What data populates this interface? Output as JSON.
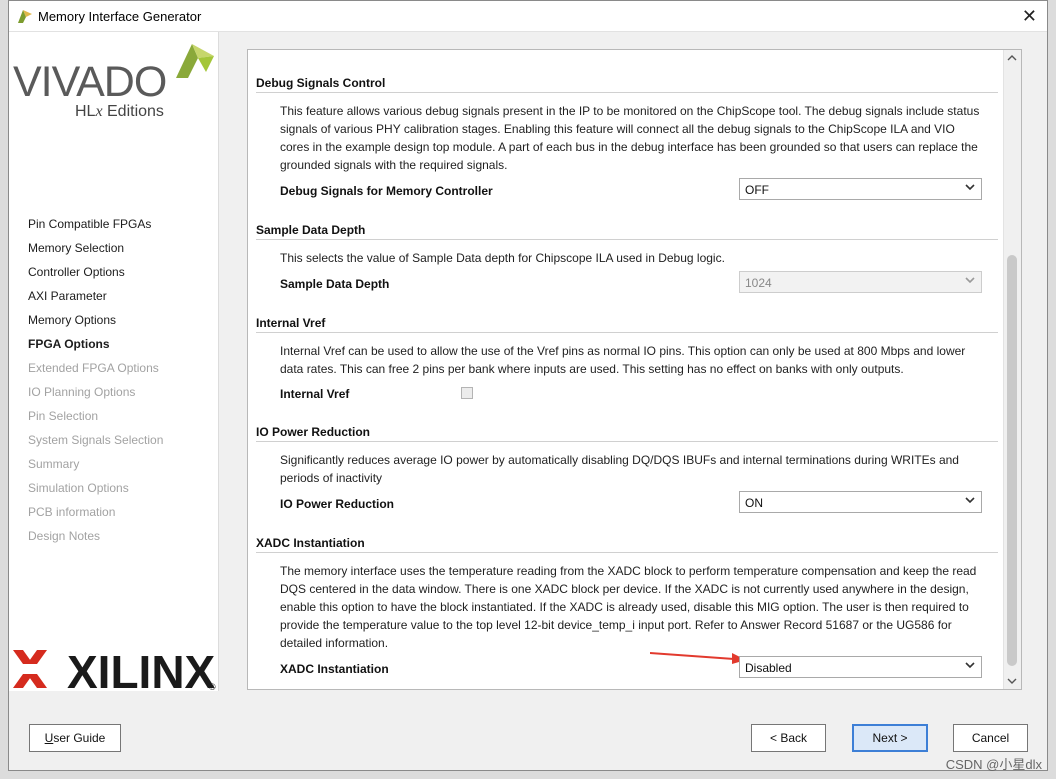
{
  "window": {
    "title": "Memory Interface Generator",
    "close_glyph": "✕"
  },
  "brand": {
    "product": "VIVADO",
    "edition_prefix": "HL",
    "edition_italic": "x",
    "edition_suffix": " Editions",
    "vendor": "XILINX",
    "vendor_mark": "®"
  },
  "nav": {
    "items": [
      {
        "label": "Pin Compatible FPGAs",
        "state": "done"
      },
      {
        "label": "Memory Selection",
        "state": "done"
      },
      {
        "label": "Controller Options",
        "state": "done"
      },
      {
        "label": "AXI Parameter",
        "state": "done"
      },
      {
        "label": "Memory Options",
        "state": "done"
      },
      {
        "label": "FPGA Options",
        "state": "active"
      },
      {
        "label": "Extended FPGA Options",
        "state": "disabled"
      },
      {
        "label": "IO Planning Options",
        "state": "disabled"
      },
      {
        "label": "Pin Selection",
        "state": "disabled"
      },
      {
        "label": "System Signals Selection",
        "state": "disabled"
      },
      {
        "label": "Summary",
        "state": "disabled"
      },
      {
        "label": "Simulation Options",
        "state": "disabled"
      },
      {
        "label": "PCB information",
        "state": "disabled"
      },
      {
        "label": "Design Notes",
        "state": "disabled"
      }
    ]
  },
  "sections": {
    "debug": {
      "title": "Debug Signals Control",
      "desc": "This feature allows various debug signals present in the IP to be monitored on the ChipScope tool. The debug signals include status signals of various PHY calibration stages. Enabling this feature will connect all the debug signals to the ChipScope ILA and VIO cores in the example design top module. A part of each bus in the debug interface has been grounded so that users can replace the grounded signals with the required signals.",
      "label": "Debug Signals for Memory Controller",
      "value": "OFF"
    },
    "sample": {
      "title": "Sample Data Depth",
      "desc": "This selects the value of Sample Data depth for Chipscope ILA used in Debug logic.",
      "label": "Sample Data Depth",
      "value": "1024"
    },
    "vref": {
      "title": "Internal Vref",
      "desc": "Internal Vref can be used to allow the use of the Vref pins as normal IO pins. This option can only be used at 800 Mbps and lower data rates. This can free 2 pins per bank where inputs are used. This setting has no effect on banks with only outputs.",
      "label": "Internal Vref",
      "checked": false
    },
    "iopower": {
      "title": "IO Power Reduction",
      "desc": "Significantly reduces average IO power by automatically disabling DQ/DQS IBUFs and internal terminations during WRITEs and periods of inactivity",
      "label": "IO Power Reduction",
      "value": "ON"
    },
    "xadc": {
      "title": "XADC Instantiation",
      "desc": "The memory interface uses the temperature reading from the XADC block to perform temperature compensation and keep the read DQS centered in the data window. There is one XADC block per device. If the XADC is not currently used anywhere in the design, enable this option to have the block instantiated. If the XADC is already used, disable this MIG option. The user is then required to provide the temperature value to the top level 12-bit device_temp_i input port. Refer to Answer Record 51687 or the UG586 for detailed information.",
      "label": "XADC Instantiation",
      "value": "Disabled"
    }
  },
  "buttons": {
    "user_guide": {
      "label": "User Guide",
      "mnemonic": "U"
    },
    "back": {
      "label": "< Back"
    },
    "next": {
      "label": "Next >"
    },
    "cancel": {
      "label": "Cancel"
    }
  },
  "watermark": "CSDN @小星dlx",
  "colors": {
    "accent": "#3d7fd6",
    "arrow": "#e23a2e",
    "xilinx_red": "#d52b1e",
    "vivado_green": "#a4c639"
  }
}
